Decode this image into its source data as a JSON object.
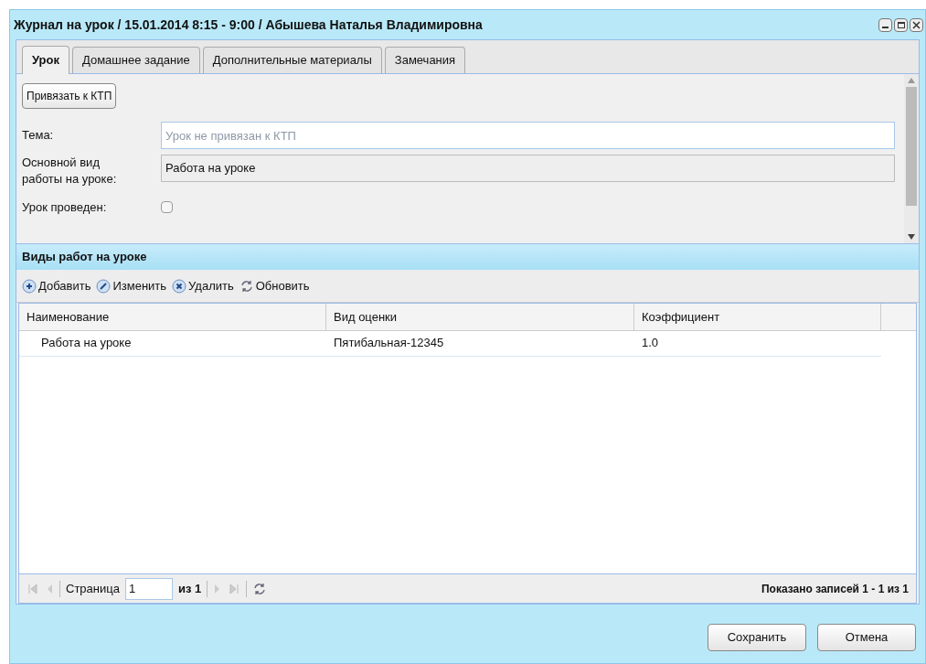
{
  "window": {
    "title": "Журнал на урок / 15.01.2014 8:15 - 9:00 / Абышева Наталья Владимировна"
  },
  "tabs": [
    {
      "label": "Урок",
      "selected": true
    },
    {
      "label": "Домашнее задание",
      "selected": false
    },
    {
      "label": "Дополнительные материалы",
      "selected": false
    },
    {
      "label": "Замечания",
      "selected": false
    }
  ],
  "form": {
    "link_button": "Привязать к КТП",
    "topic": {
      "label": "Тема:",
      "placeholder": "Урок не привязан к КТП"
    },
    "work_type": {
      "label": "Основной вид работы на уроке:",
      "value": "Работа на уроке"
    },
    "held": {
      "label": "Урок проведен:",
      "checked": false
    }
  },
  "grid": {
    "title": "Виды работ на уроке",
    "toolbar": [
      {
        "kind": "add",
        "label": "Добавить"
      },
      {
        "kind": "edit",
        "label": "Изменить"
      },
      {
        "kind": "delete",
        "label": "Удалить"
      },
      {
        "kind": "refresh",
        "label": "Обновить"
      }
    ],
    "columns": [
      "Наименование",
      "Вид оценки",
      "Коэффициент"
    ],
    "rows": [
      {
        "cells": [
          "Работа на уроке",
          "Пятибальная-12345",
          "1.0"
        ],
        "selected": false
      }
    ],
    "pager": {
      "page_label": "Страница",
      "page": "1",
      "of": "из 1",
      "summary": "Показано записей 1 - 1 из 1"
    }
  },
  "buttons": [
    "Сохранить",
    "Отмена"
  ]
}
